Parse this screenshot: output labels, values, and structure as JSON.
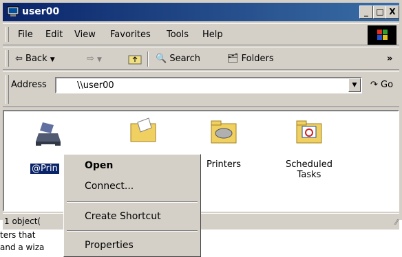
{
  "window": {
    "title": "user00",
    "min_label": "_",
    "max_label": "□",
    "close_label": "X"
  },
  "menubar": {
    "items": [
      "File",
      "Edit",
      "View",
      "Favorites",
      "Tools",
      "Help"
    ]
  },
  "toolbar": {
    "back": "Back",
    "search": "Search",
    "folders": "Folders",
    "chevron": "»"
  },
  "address": {
    "label": "Address",
    "value": "\\\\user00",
    "go": "Go"
  },
  "icons": {
    "printer_item": "@Prin",
    "printers": "Printers",
    "scheduled_line1": "Scheduled",
    "scheduled_line2": "Tasks"
  },
  "status": {
    "text": "1 object("
  },
  "background_text": {
    "line1": "ters that",
    "line2": "and a wiza"
  },
  "context_menu": {
    "open": "Open",
    "connect": "Connect...",
    "create_shortcut": "Create Shortcut",
    "properties": "Properties"
  },
  "colors": {
    "title_bar": "#0a246a",
    "selection": "#0a246a",
    "face": "#d4d0c8"
  }
}
